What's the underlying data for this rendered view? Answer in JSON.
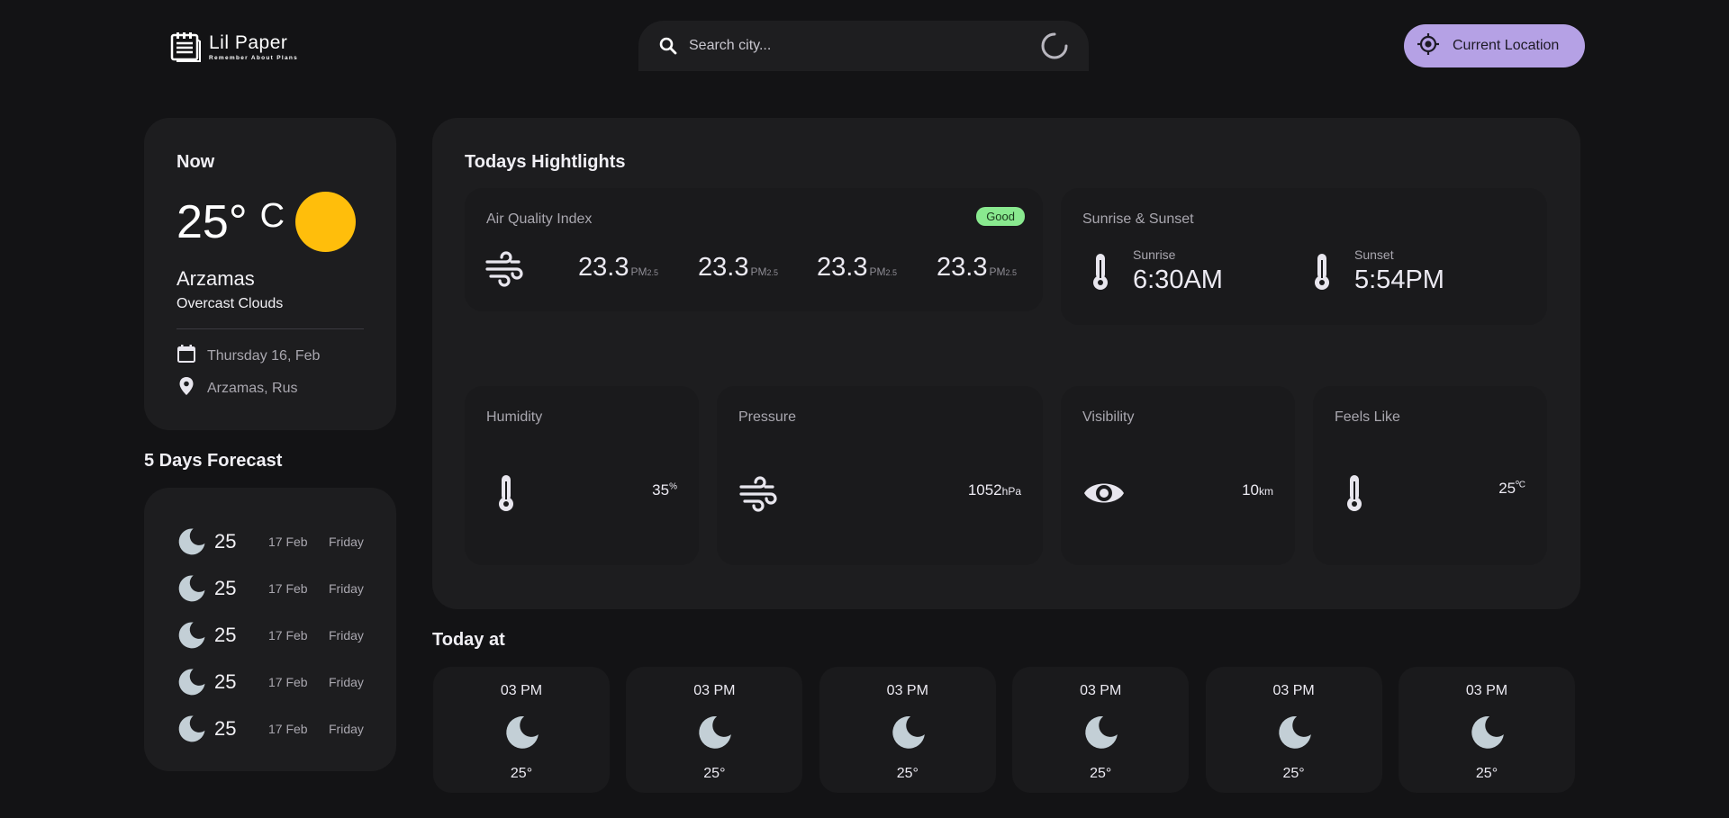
{
  "header": {
    "logo_title": "Lil Paper",
    "logo_tagline": "Remember About Plans",
    "search_placeholder": "Search city...",
    "current_location_label": "Current Location"
  },
  "now": {
    "title": "Now",
    "temperature": "25°",
    "unit": "C",
    "city": "Arzamas",
    "description": "Overcast Clouds",
    "date": "Thursday 16, Feb",
    "location": "Arzamas, Rus",
    "sun_color": "#ffbe0b"
  },
  "forecast": {
    "title": "5 Days Forecast",
    "items": [
      {
        "temp": "25",
        "date": "17 Feb",
        "day": "Friday"
      },
      {
        "temp": "25",
        "date": "17 Feb",
        "day": "Friday"
      },
      {
        "temp": "25",
        "date": "17 Feb",
        "day": "Friday"
      },
      {
        "temp": "25",
        "date": "17 Feb",
        "day": "Friday"
      },
      {
        "temp": "25",
        "date": "17 Feb",
        "day": "Friday"
      }
    ]
  },
  "highlights": {
    "title": "Todays Hightlights",
    "aqi": {
      "label": "Air Quality Index",
      "badge": "Good",
      "badge_color": "#89e98f",
      "values": [
        {
          "value": "23.3",
          "unit": "PM",
          "sub": "2.5"
        },
        {
          "value": "23.3",
          "unit": "PM",
          "sub": "2.5"
        },
        {
          "value": "23.3",
          "unit": "PM",
          "sub": "2.5"
        },
        {
          "value": "23.3",
          "unit": "PM",
          "sub": "2.5"
        }
      ]
    },
    "sun": {
      "label": "Sunrise & Sunset",
      "sunrise_label": "Sunrise",
      "sunrise_time": "6:30AM",
      "sunset_label": "Sunset",
      "sunset_time": "5:54PM"
    },
    "humidity": {
      "label": "Humidity",
      "value": "35",
      "unit": "%"
    },
    "pressure": {
      "label": "Pressure",
      "value": "1052",
      "unit": "hPa"
    },
    "visibility": {
      "label": "Visibility",
      "value": "10",
      "unit": "km"
    },
    "feels_like": {
      "label": "Feels Like",
      "value": "25",
      "unit": "ºC"
    }
  },
  "today_at": {
    "title": "Today at",
    "items": [
      {
        "time": "03 PM",
        "temp": "25°"
      },
      {
        "time": "03 PM",
        "temp": "25°"
      },
      {
        "time": "03 PM",
        "temp": "25°"
      },
      {
        "time": "03 PM",
        "temp": "25°"
      },
      {
        "time": "03 PM",
        "temp": "25°"
      },
      {
        "time": "03 PM",
        "temp": "25°"
      }
    ]
  },
  "colors": {
    "accent": "#b5a1e5",
    "background": "#131315",
    "card": "#1d1d1f"
  }
}
